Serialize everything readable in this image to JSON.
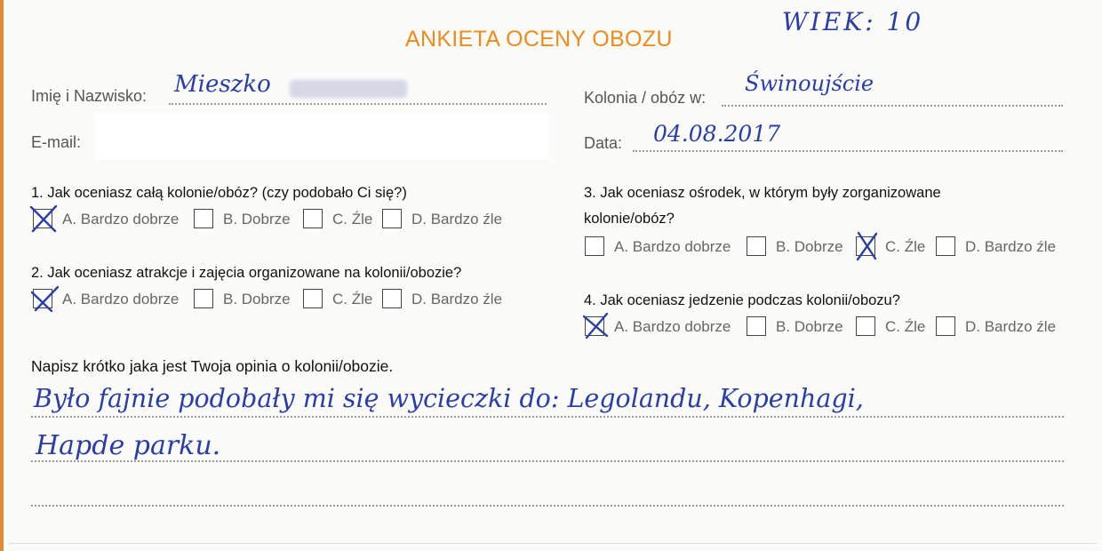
{
  "title": "ANKIETA OCENY OBOZU",
  "handwritten": {
    "age": "WIEK: 10",
    "name": "Mieszko",
    "camp": "Świnoujście",
    "date": "04.08.2017",
    "opinion_line1": "Było fajnie podobały mi się wycieczki do: Legolandu, Kopenhagi,",
    "opinion_line2": "Hapde parku."
  },
  "fields": {
    "name_label": "Imię i Nazwisko:",
    "email_label": "E-mail:",
    "camp_label": "Kolonia / obóz w:",
    "date_label": "Data:"
  },
  "options": [
    "A. Bardzo dobrze",
    "B. Dobrze",
    "C. Źle",
    "D. Bardzo źle"
  ],
  "questions": [
    {
      "text": "1. Jak oceniasz całą kolonie/obóz? (czy podobało Ci się?)",
      "selected": "A"
    },
    {
      "text": "2.  Jak oceniasz atrakcje i zajęcia organizowane na kolonii/obozie?",
      "selected": "A"
    },
    {
      "text_line1": "3. Jak oceniasz ośrodek, w którym były zorganizowane",
      "text_line2": "kolonie/obóz?",
      "selected": "C"
    },
    {
      "text": "4.  Jak oceniasz jedzenie podczas kolonii/obozu?",
      "selected": "A"
    }
  ],
  "opinion_label": "Napisz krótko jaka jest Twoja opinia o kolonii/obozie."
}
